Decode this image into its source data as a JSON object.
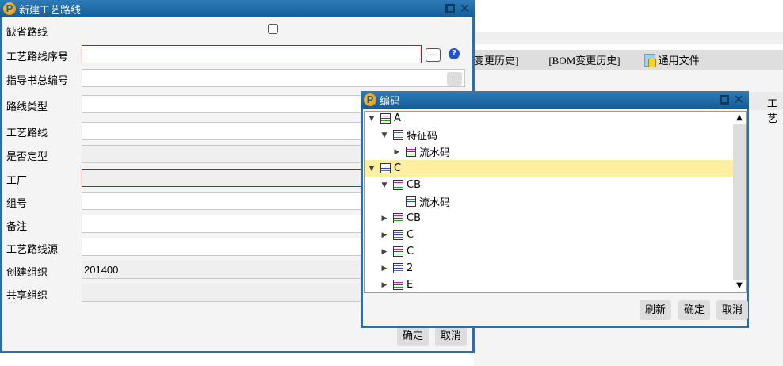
{
  "background": {
    "toolbar": [
      "变更历史]",
      "[BOM变更历史]",
      "通用文件"
    ],
    "right_tab": "工艺"
  },
  "dialog_main": {
    "title": "新建工艺路线",
    "fields": [
      {
        "label": "缺省路线",
        "type": "checkbox",
        "checked": false
      },
      {
        "label": "工艺路线序号",
        "value": "",
        "required": true
      },
      {
        "label": "指导书总编号",
        "value": ""
      },
      {
        "label": "路线类型",
        "value": ""
      },
      {
        "label": "工艺路线",
        "value": ""
      },
      {
        "label": "是否定型",
        "value": "",
        "disabled": true
      },
      {
        "label": "工厂",
        "value": "",
        "required": true,
        "disabled": true
      },
      {
        "label": "组号",
        "value": ""
      },
      {
        "label": "备注",
        "value": ""
      },
      {
        "label": "工艺路线源",
        "value": ""
      },
      {
        "label": "创建组织",
        "value": "201400",
        "disabled": true
      },
      {
        "label": "共享组织",
        "value": "",
        "disabled": true
      }
    ],
    "browse_label": "...",
    "help_label": "?",
    "ok": "确定",
    "cancel": "取消"
  },
  "dialog_code": {
    "title": "编码",
    "tree": [
      {
        "label": "A",
        "level": 0,
        "state": "expanded"
      },
      {
        "label": "特征码",
        "level": 1,
        "state": "expanded"
      },
      {
        "label": "流水码",
        "level": 2,
        "state": "collapsed"
      },
      {
        "label": "C",
        "level": 0,
        "state": "expanded",
        "selected": true
      },
      {
        "label": "CB",
        "level": 1,
        "state": "expanded"
      },
      {
        "label": "流水码",
        "level": 2,
        "state": "leaf"
      },
      {
        "label": "CB",
        "level": 1,
        "state": "collapsed"
      },
      {
        "label": "C",
        "level": 1,
        "state": "collapsed"
      },
      {
        "label": "C",
        "level": 1,
        "state": "collapsed"
      },
      {
        "label": "2",
        "level": 1,
        "state": "collapsed"
      },
      {
        "label": "E",
        "level": 1,
        "state": "collapsed"
      }
    ],
    "refresh": "刷新",
    "ok": "确定",
    "cancel": "取消"
  }
}
